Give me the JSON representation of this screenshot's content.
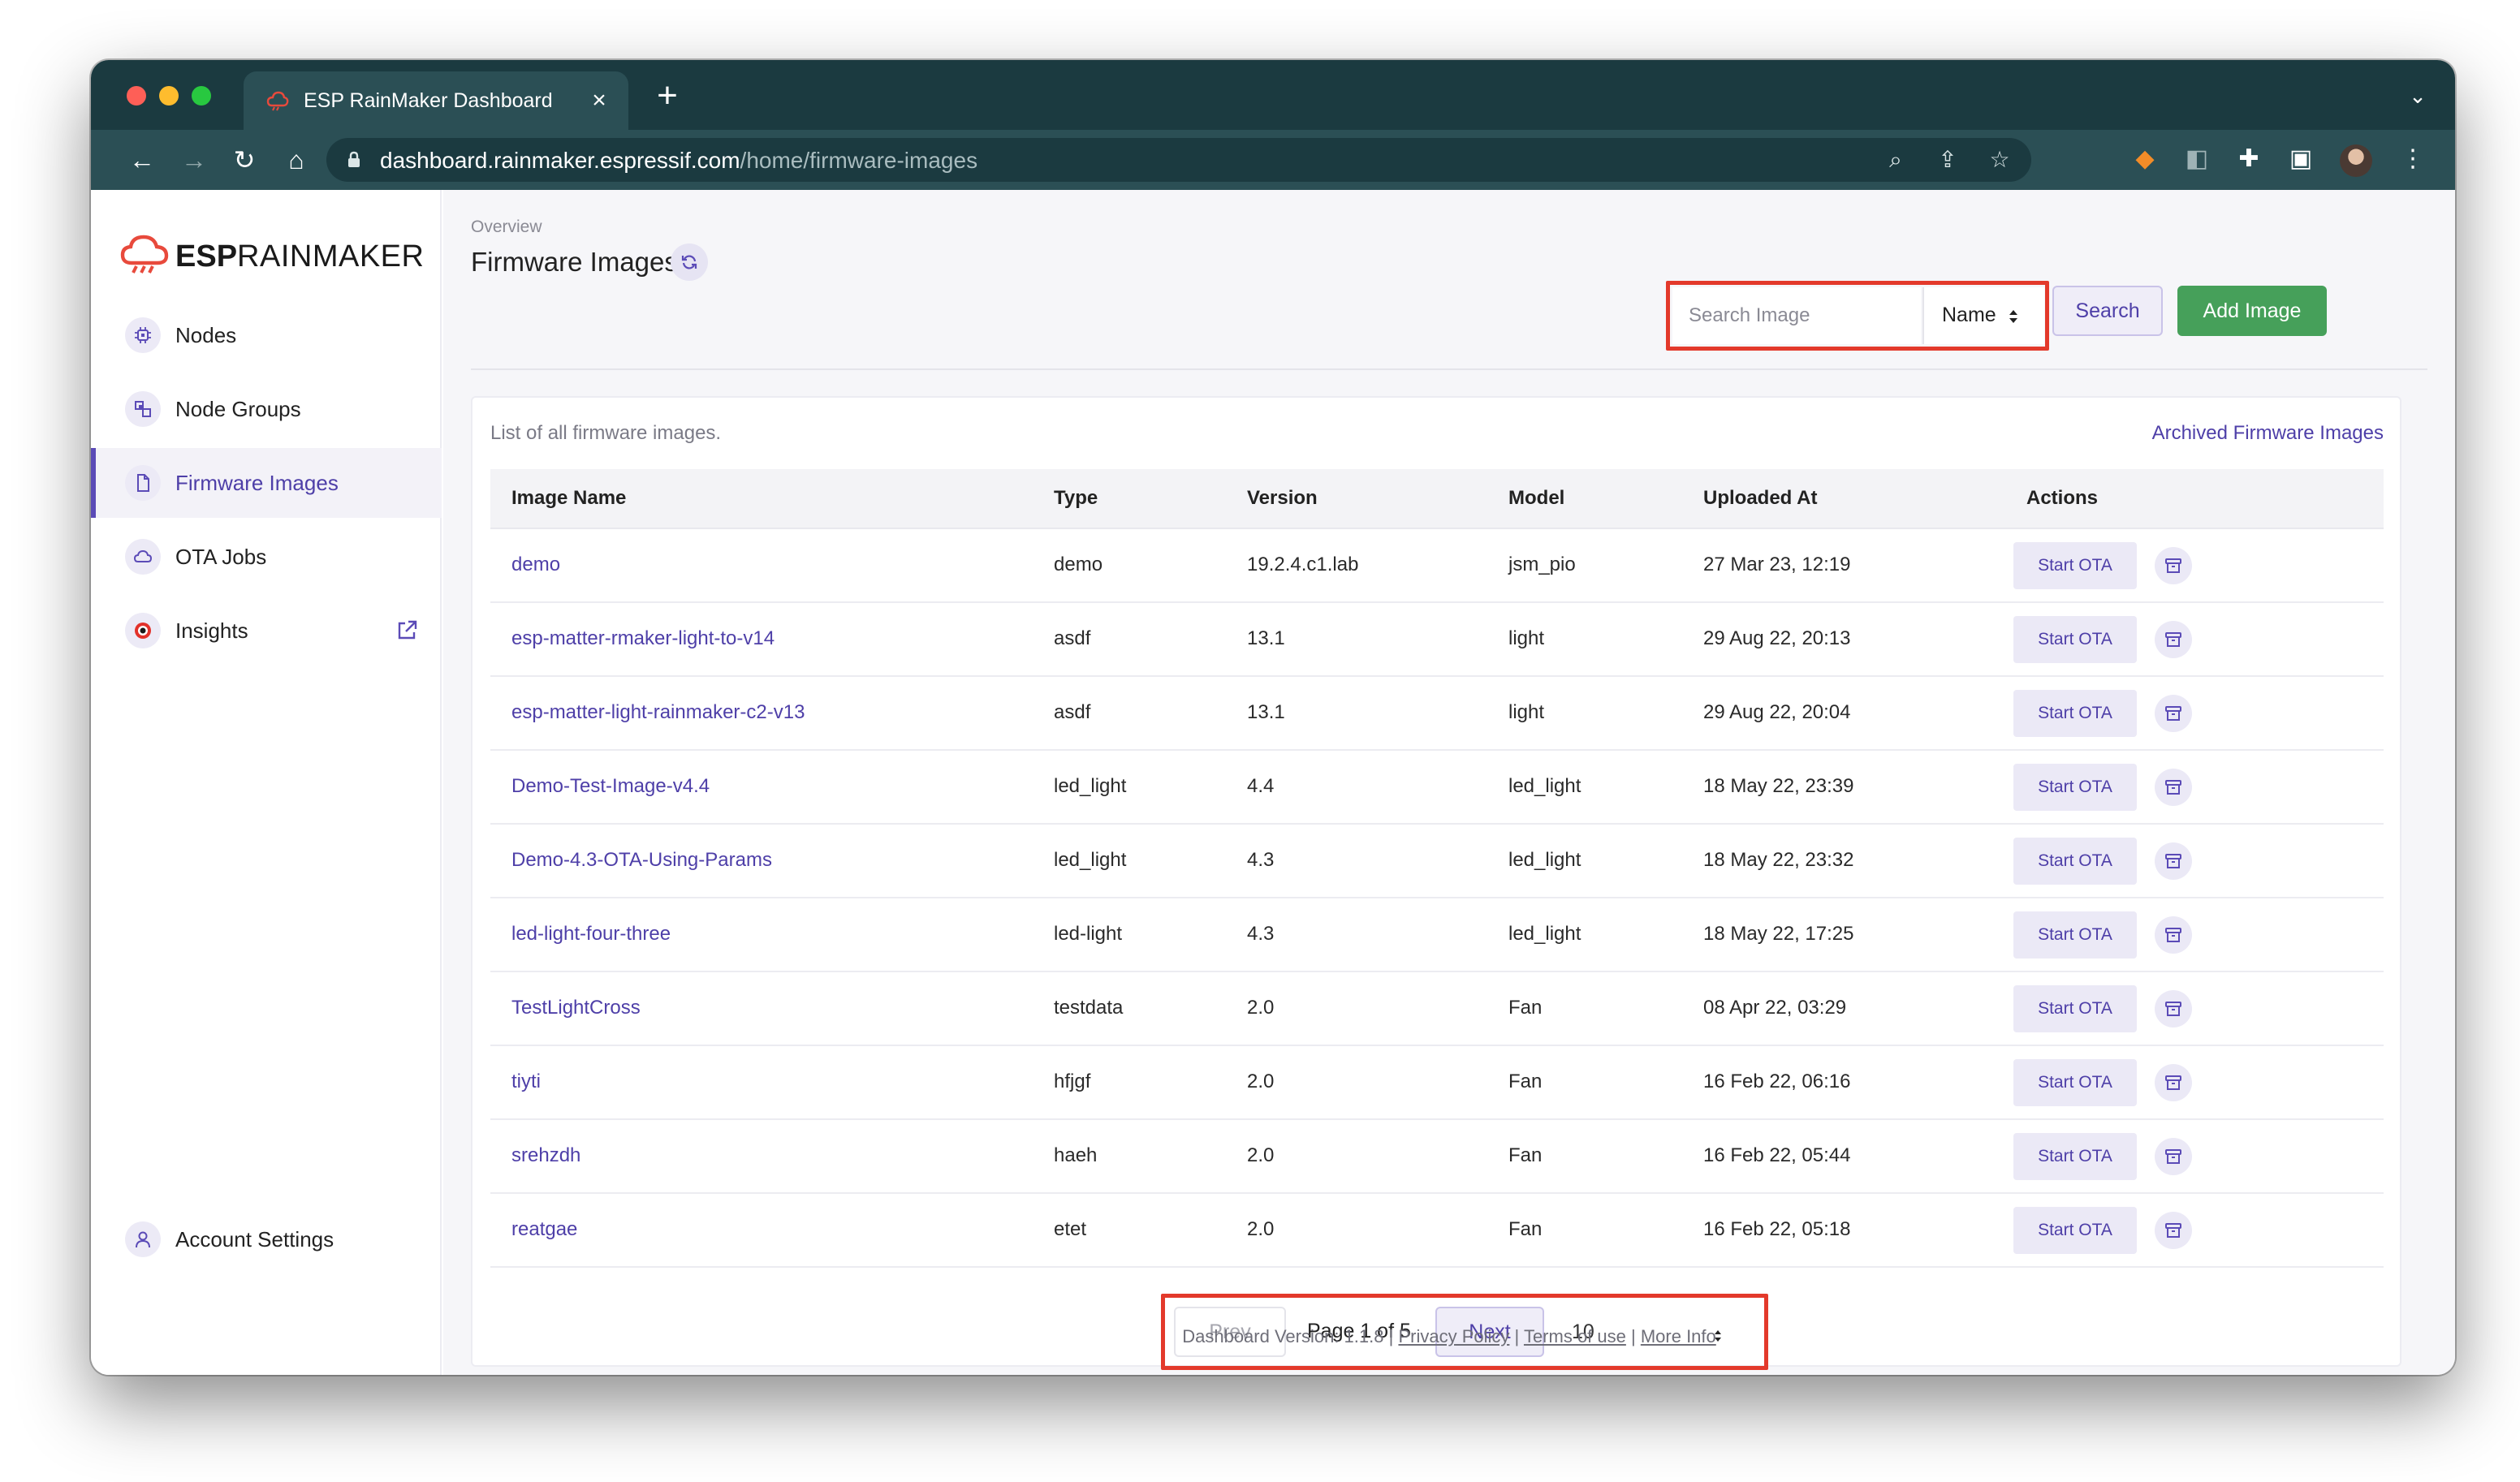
{
  "browser": {
    "tab_title": "ESP RainMaker Dashboard",
    "url_host": "dashboard.rainmaker.espressif.com",
    "url_path": "/home/firmware-images"
  },
  "logo": {
    "brand_bold": "ESP",
    "brand_light": "RAINMAKER"
  },
  "sidebar": {
    "items": [
      {
        "label": "Nodes",
        "icon": "chip-icon"
      },
      {
        "label": "Node Groups",
        "icon": "node-groups-icon"
      },
      {
        "label": "Firmware Images",
        "icon": "file-icon",
        "active": true
      },
      {
        "label": "OTA Jobs",
        "icon": "cloud-icon"
      },
      {
        "label": "Insights",
        "icon": "insights-icon",
        "external": true
      }
    ],
    "account_settings": "Account Settings"
  },
  "header": {
    "breadcrumb": "Overview",
    "title": "Firmware Images",
    "search_placeholder": "Search Image",
    "search_field": "Name",
    "search_button": "Search",
    "add_button": "Add Image"
  },
  "card": {
    "description": "List of all firmware images.",
    "archived_link": "Archived Firmware Images"
  },
  "table": {
    "columns": [
      "Image Name",
      "Type",
      "Version",
      "Model",
      "Uploaded At",
      "Actions"
    ],
    "ota_label": "Start OTA",
    "rows": [
      {
        "name": "demo",
        "type": "demo",
        "version": "19.2.4.c1.lab",
        "model": "jsm_pio",
        "uploaded": "27 Mar 23, 12:19"
      },
      {
        "name": "esp-matter-rmaker-light-to-v14",
        "type": "asdf",
        "version": "13.1",
        "model": "light",
        "uploaded": "29 Aug 22, 20:13"
      },
      {
        "name": "esp-matter-light-rainmaker-c2-v13",
        "type": "asdf",
        "version": "13.1",
        "model": "light",
        "uploaded": "29 Aug 22, 20:04"
      },
      {
        "name": "Demo-Test-Image-v4.4",
        "type": "led_light",
        "version": "4.4",
        "model": "led_light",
        "uploaded": "18 May 22, 23:39"
      },
      {
        "name": "Demo-4.3-OTA-Using-Params",
        "type": "led_light",
        "version": "4.3",
        "model": "led_light",
        "uploaded": "18 May 22, 23:32"
      },
      {
        "name": "led-light-four-three",
        "type": "led-light",
        "version": "4.3",
        "model": "led_light",
        "uploaded": "18 May 22, 17:25"
      },
      {
        "name": "TestLightCross",
        "type": "testdata",
        "version": "2.0",
        "model": "Fan",
        "uploaded": "08 Apr 22, 03:29"
      },
      {
        "name": "tiyti",
        "type": "hfjgf",
        "version": "2.0",
        "model": "Fan",
        "uploaded": "16 Feb 22, 06:16"
      },
      {
        "name": "srehzdh",
        "type": "haeh",
        "version": "2.0",
        "model": "Fan",
        "uploaded": "16 Feb 22, 05:44"
      },
      {
        "name": "reatgae",
        "type": "etet",
        "version": "2.0",
        "model": "Fan",
        "uploaded": "16 Feb 22, 05:18"
      }
    ]
  },
  "pagination": {
    "prev": "Prev",
    "page_text": "Page 1 of 5",
    "next": "Next",
    "per_page": "10"
  },
  "footer": {
    "version": "Dashboard Version: 1.1.8",
    "privacy": "Privacy Policy",
    "terms": "Terms of use",
    "more": "More Info"
  },
  "colors": {
    "accent": "#4e3fa8",
    "add_button": "#46a05a",
    "highlight": "#e3392b",
    "browser_frame": "#1b3a40"
  }
}
